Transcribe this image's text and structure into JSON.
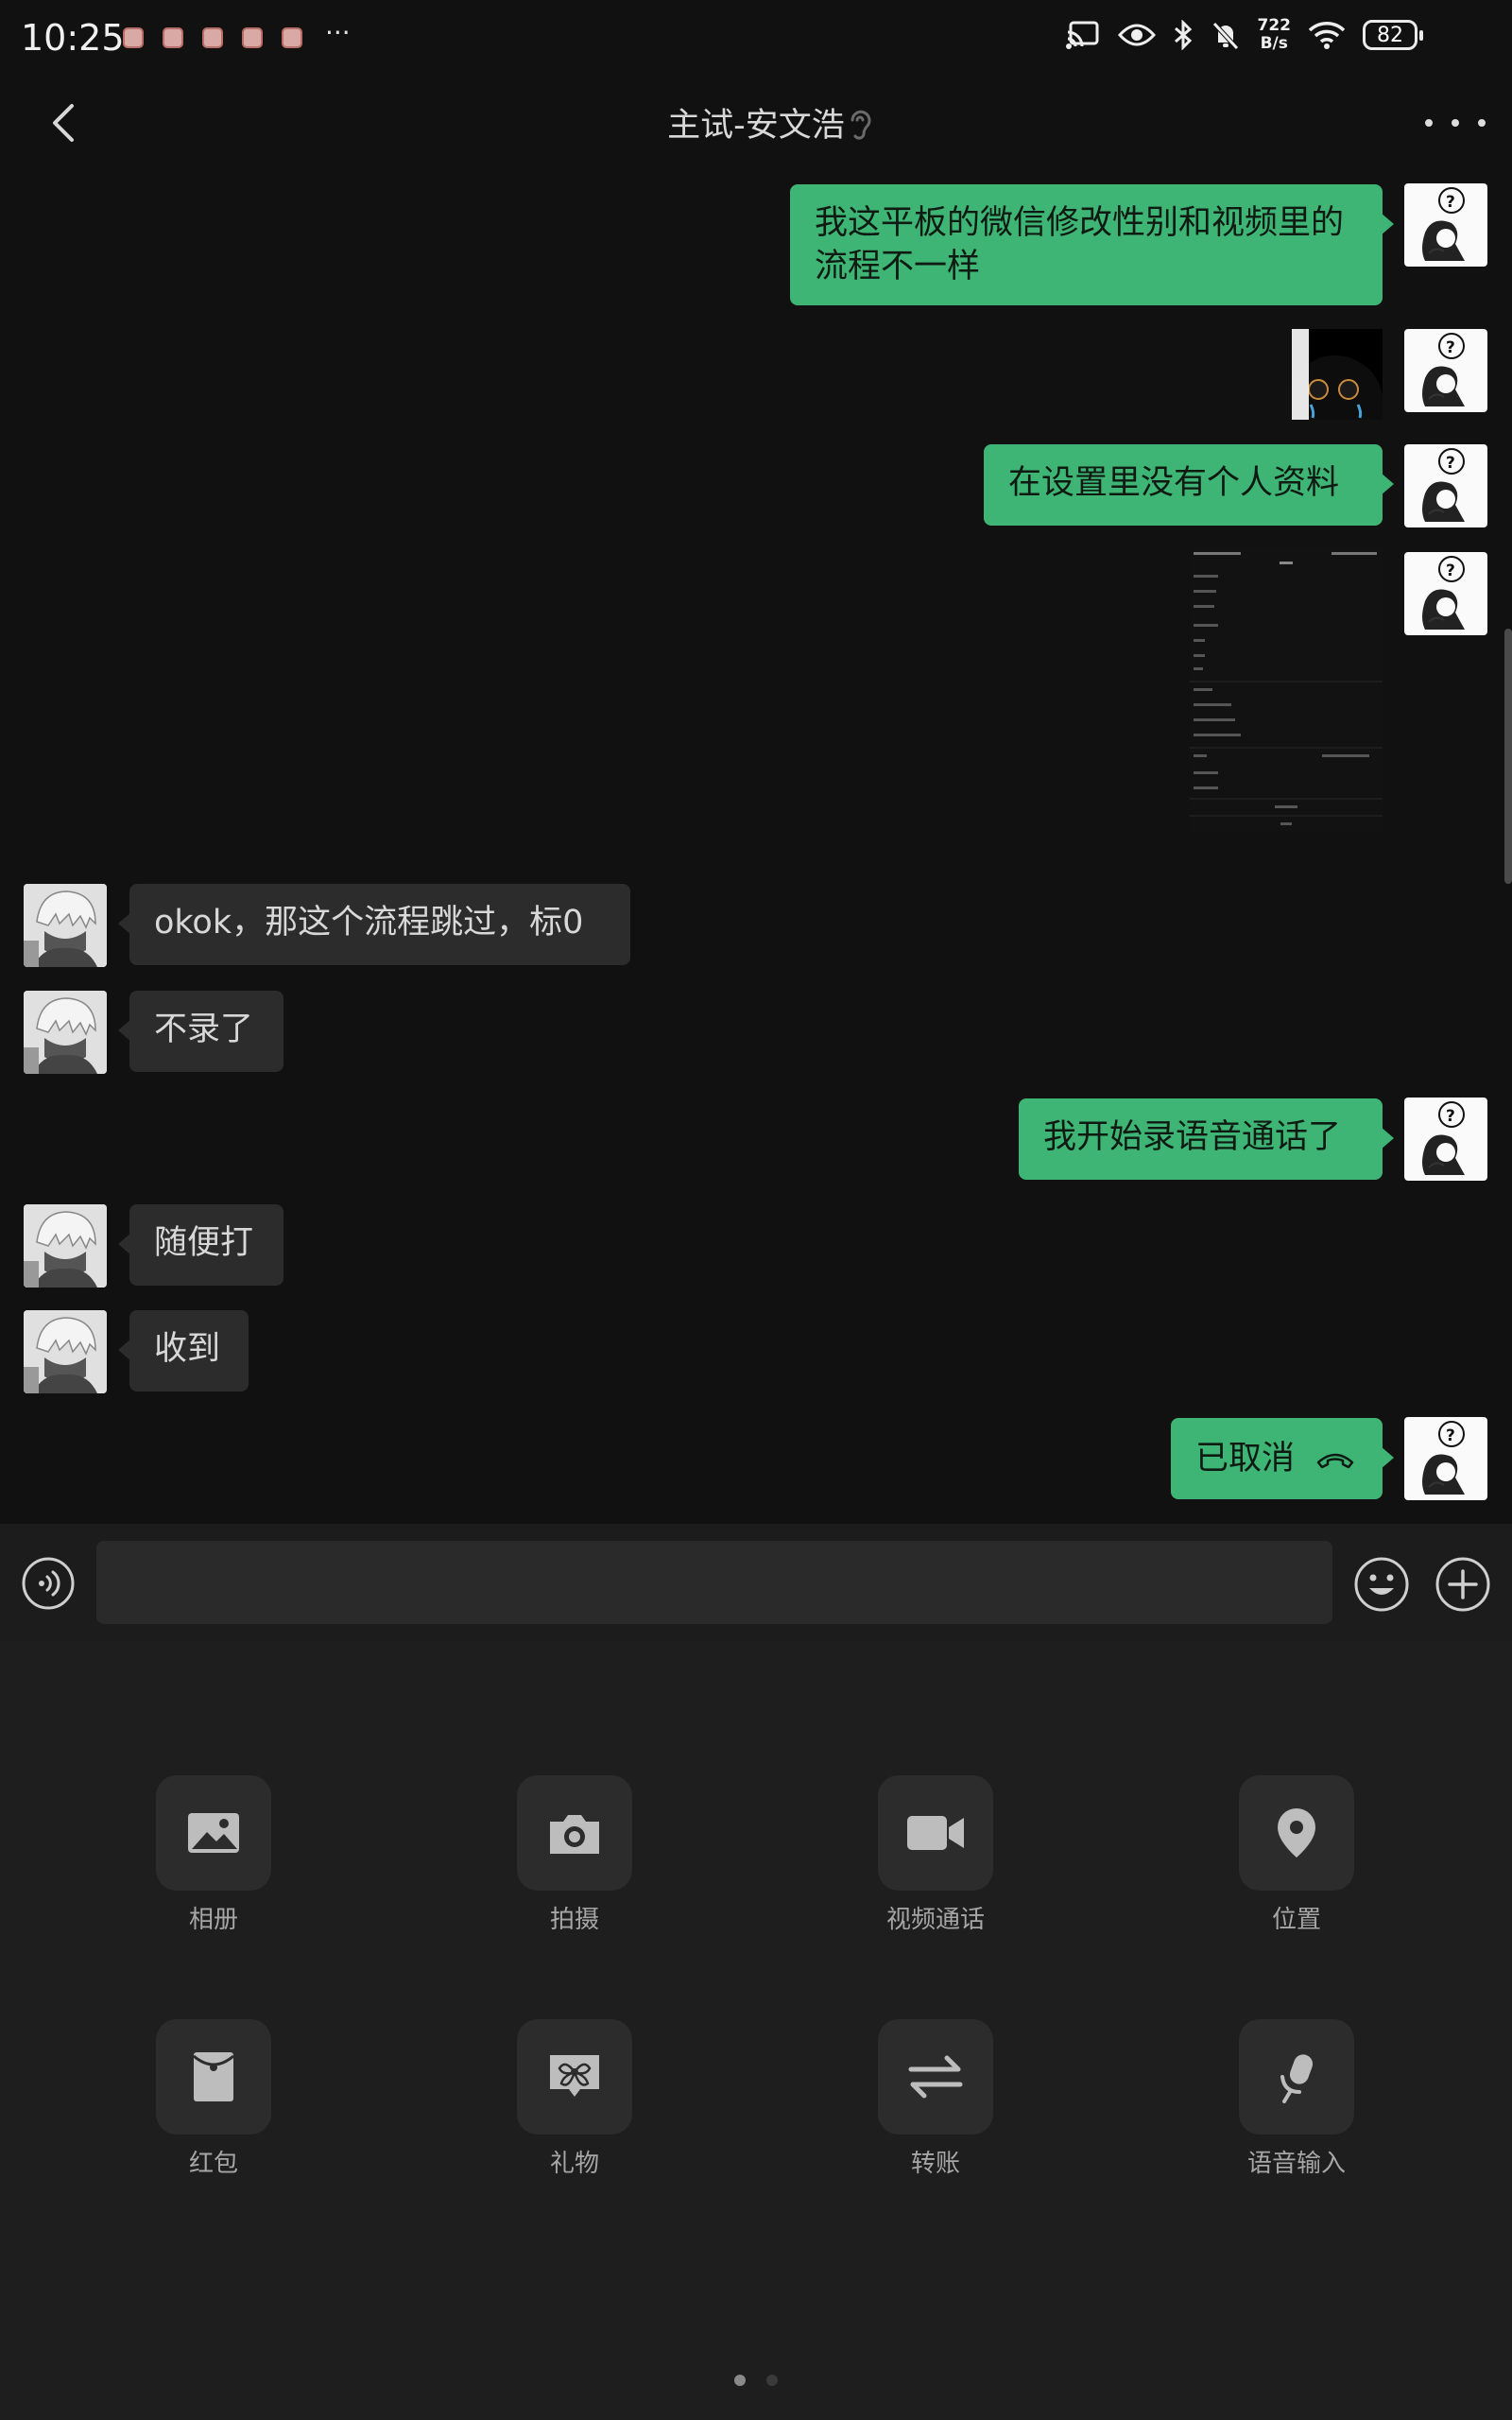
{
  "status_bar": {
    "time": "10:25",
    "more": "···",
    "net_speed_value": "722",
    "net_speed_unit": "B/s",
    "battery": "82"
  },
  "header": {
    "title": "主试-安文浩"
  },
  "messages": [
    {
      "from": "me",
      "type": "text",
      "text": "我这平板的微信修改性别和视频里的流程不一样"
    },
    {
      "from": "me",
      "type": "image"
    },
    {
      "from": "me",
      "type": "text",
      "text": "在设置里没有个人资料"
    },
    {
      "from": "me",
      "type": "image"
    },
    {
      "from": "them",
      "type": "text",
      "text": "okok，那这个流程跳过，标0"
    },
    {
      "from": "them",
      "type": "text",
      "text": "不录了"
    },
    {
      "from": "me",
      "type": "text",
      "text": "我开始录语音通话了"
    },
    {
      "from": "them",
      "type": "text",
      "text": "随便打"
    },
    {
      "from": "them",
      "type": "text",
      "text": "收到"
    },
    {
      "from": "me",
      "type": "call",
      "text": "已取消"
    }
  ],
  "input": {
    "value": "",
    "placeholder": ""
  },
  "tools": [
    {
      "label": "相册",
      "icon": "album-icon"
    },
    {
      "label": "拍摄",
      "icon": "camera-icon"
    },
    {
      "label": "视频通话",
      "icon": "video-call-icon"
    },
    {
      "label": "位置",
      "icon": "location-icon"
    },
    {
      "label": "红包",
      "icon": "red-packet-icon"
    },
    {
      "label": "礼物",
      "icon": "gift-icon"
    },
    {
      "label": "转账",
      "icon": "transfer-icon"
    },
    {
      "label": "语音输入",
      "icon": "voice-input-icon"
    }
  ],
  "pagination": {
    "total": 2,
    "current": 1
  },
  "colors": {
    "background": "#111111",
    "my_bubble": "#3eb575",
    "their_bubble": "#2c2c2c",
    "panel": "#1e1e1e"
  }
}
